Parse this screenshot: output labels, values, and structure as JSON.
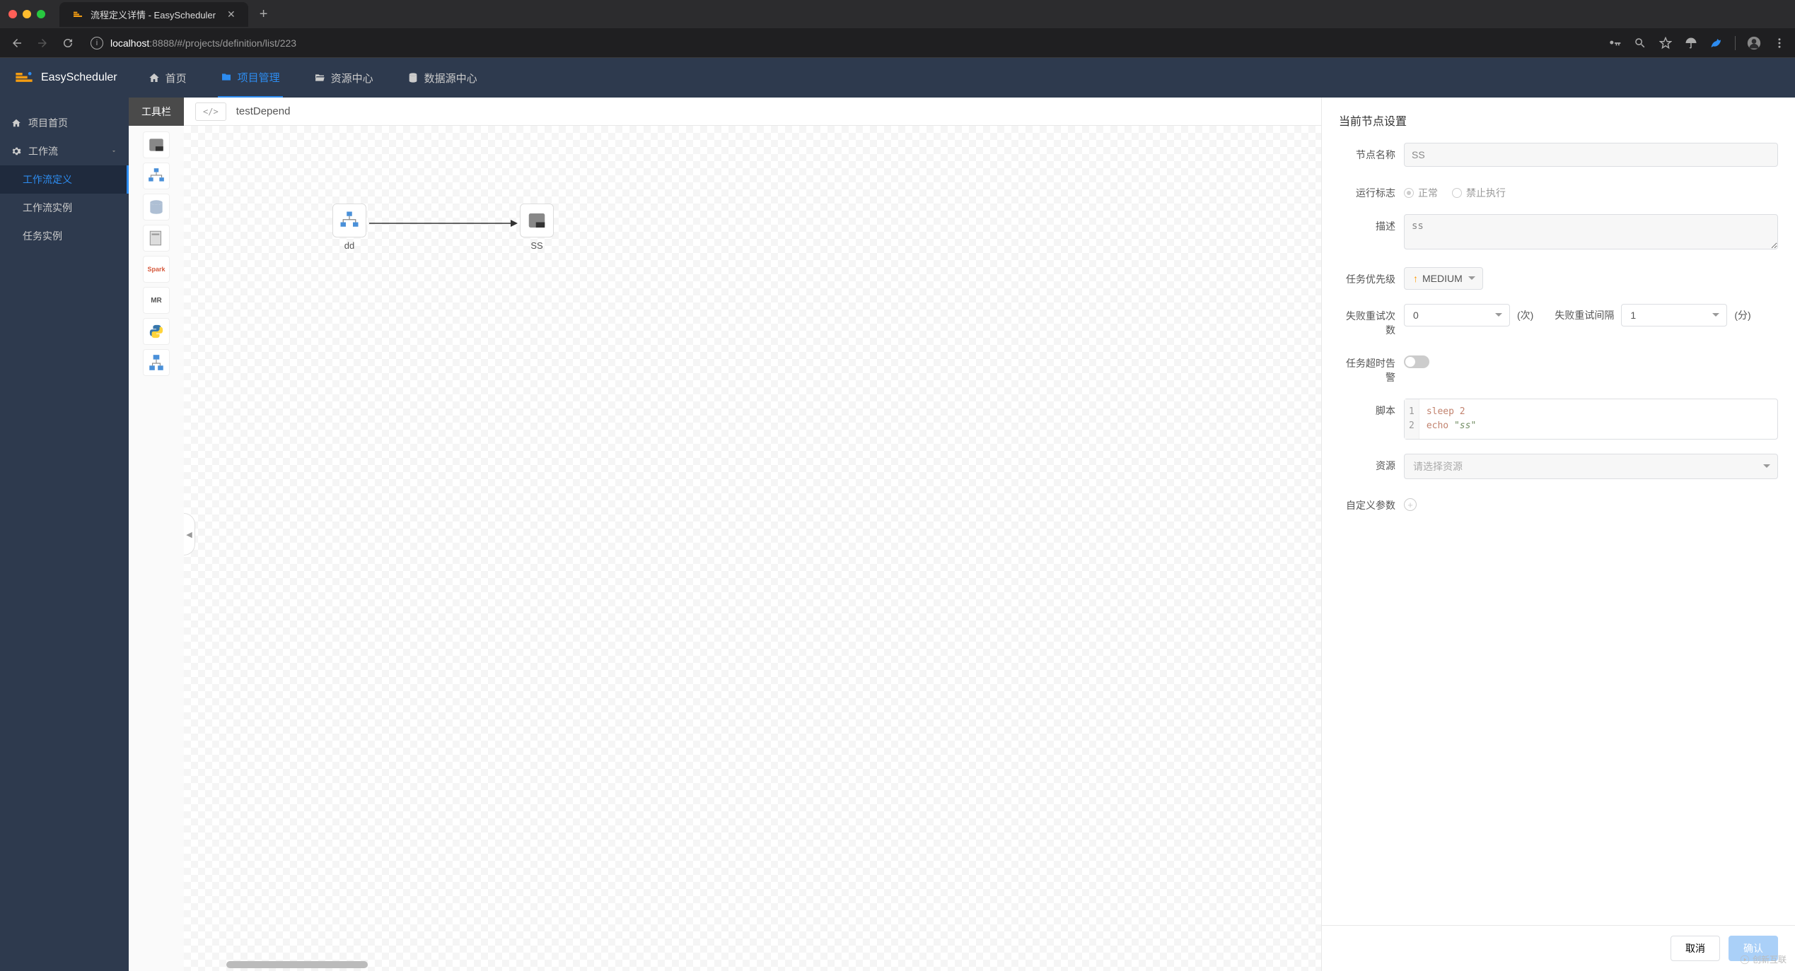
{
  "browser": {
    "tab_title": "流程定义详情 - EasyScheduler",
    "url_host": "localhost",
    "url_port": ":8888",
    "url_path": "/#/projects/definition/list/223"
  },
  "header": {
    "app_name": "EasyScheduler",
    "nav": {
      "home": "首页",
      "project": "项目管理",
      "resource": "资源中心",
      "datasource": "数据源中心"
    }
  },
  "sidebar": {
    "project_home": "项目首页",
    "workflow": "工作流",
    "workflow_def": "工作流定义",
    "workflow_inst": "工作流实例",
    "task_inst": "任务实例"
  },
  "canvas": {
    "toolbox_title": "工具栏",
    "workflow_name": "testDepend",
    "nodes": {
      "dd": "dd",
      "ss": "SS"
    }
  },
  "panel": {
    "title": "当前节点设置",
    "labels": {
      "node_name": "节点名称",
      "run_flag": "运行标志",
      "desc": "描述",
      "priority": "任务优先级",
      "retry_count": "失败重试次数",
      "retry_interval": "失败重试间隔",
      "timeout": "任务超时告警",
      "script": "脚本",
      "resource": "资源",
      "custom_params": "自定义参数"
    },
    "values": {
      "node_name": "SS",
      "run_flag_normal": "正常",
      "run_flag_forbid": "禁止执行",
      "desc": "ss",
      "priority": "MEDIUM",
      "retry_count": "0",
      "retry_interval": "1",
      "resource_placeholder": "请选择资源"
    },
    "units": {
      "count": "(次)",
      "interval": "(分)"
    },
    "script_lines": [
      "sleep 2",
      "echo \"ss\""
    ],
    "buttons": {
      "cancel": "取消",
      "confirm": "确认"
    }
  },
  "watermark": "创新互联"
}
